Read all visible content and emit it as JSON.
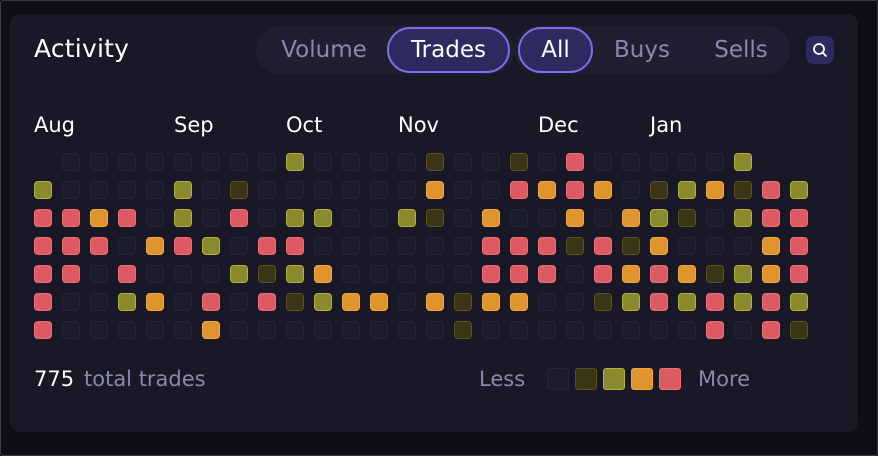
{
  "activity": {
    "title": "Activity",
    "metric_tabs": [
      {
        "label": "Volume",
        "active": false
      },
      {
        "label": "Trades",
        "active": true
      }
    ],
    "side_tabs": [
      {
        "label": "All",
        "active": true
      },
      {
        "label": "Buys",
        "active": false
      },
      {
        "label": "Sells",
        "active": false
      }
    ],
    "search_icon": "search-icon",
    "months": [
      "Aug",
      "Sep",
      "Oct",
      "Nov",
      "Dec",
      "Jan"
    ],
    "total_count": "775",
    "total_label": "total trades",
    "legend": {
      "less": "Less",
      "more": "More"
    }
  },
  "colors": {
    "level0": "#1c1c2a",
    "level1": "#3a3514",
    "level2": "#8b8a2e",
    "level3": "#e0942e",
    "level4": "#dd5a63",
    "accent": "#7b6ee6"
  },
  "heatmap": {
    "weeks": 27,
    "days": 7,
    "levels": [
      "-0000000020000100104000002",
      "2000020100000030043430123142",
      "4434020402200210300303210244",
      "4440342044000000444141300034",
      "4404000212300000444043431234",
      "4002304041233031330012424242",
      "4000003000000001000000004041"
    ]
  }
}
